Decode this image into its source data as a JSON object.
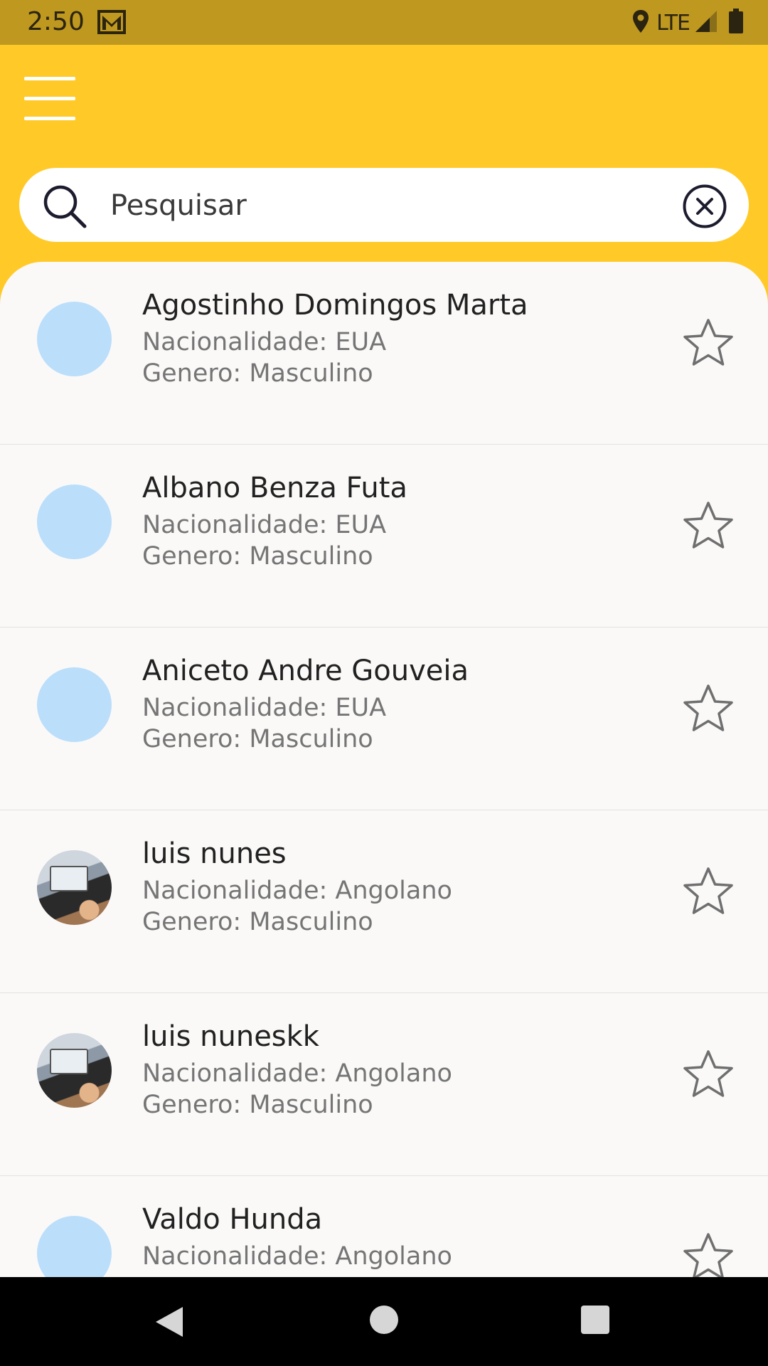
{
  "status_bar": {
    "time": "2:50",
    "network": "LTE",
    "icons": [
      "gmail-icon",
      "location-icon",
      "signal-icon",
      "battery-icon"
    ]
  },
  "app_bar": {
    "menu_icon": "hamburger-menu-icon",
    "background_color": "#FFCA28"
  },
  "search": {
    "placeholder": "Pesquisar",
    "value": "",
    "icon": "search-icon",
    "clear_icon": "clear-circle-icon"
  },
  "people": [
    {
      "name": "Agostinho Domingos Marta",
      "nationality": "Nacionalidade: EUA",
      "gender": "Genero: Masculino",
      "avatar": "placeholder"
    },
    {
      "name": "Albano Benza Futa",
      "nationality": "Nacionalidade: EUA",
      "gender": "Genero: Masculino",
      "avatar": "placeholder"
    },
    {
      "name": "Aniceto Andre Gouveia",
      "nationality": "Nacionalidade: EUA",
      "gender": "Genero: Masculino",
      "avatar": "placeholder"
    },
    {
      "name": "luis nunes",
      "nationality": "Nacionalidade: Angolano",
      "gender": "Genero: Masculino",
      "avatar": "photo"
    },
    {
      "name": "luis nuneskk",
      "nationality": "Nacionalidade: Angolano",
      "gender": "Genero: Masculino",
      "avatar": "photo"
    },
    {
      "name": "Valdo Hunda",
      "nationality": "Nacionalidade: Angolano",
      "gender": "",
      "avatar": "placeholder"
    }
  ],
  "favorite_icon": "star-outline-icon",
  "nav_bar": {
    "icons": [
      "back-icon",
      "home-icon",
      "recents-icon"
    ]
  },
  "colors": {
    "status_bar": "#BF9820",
    "accent": "#FFCA28",
    "avatar_placeholder": "#BBDEFB",
    "list_background": "#FAF9F8"
  }
}
